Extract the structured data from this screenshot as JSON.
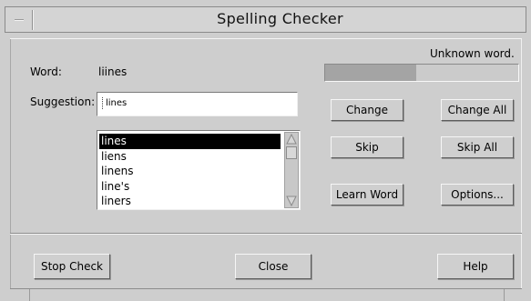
{
  "window": {
    "title": "Spelling Checker"
  },
  "status": {
    "message": "Unknown word.",
    "progress_fraction": 0.47
  },
  "word": {
    "label": "Word:",
    "value": "liines"
  },
  "suggestion": {
    "label": "Suggestion:",
    "value": "lines"
  },
  "suggestions_list": [
    "lines",
    "liens",
    "linens",
    "line's",
    "liners"
  ],
  "selected_index": 0,
  "buttons": {
    "change": "Change",
    "change_all": "Change All",
    "skip": "Skip",
    "skip_all": "Skip All",
    "learn_word": "Learn Word",
    "options": "Options...",
    "stop_check": "Stop Check",
    "close": "Close",
    "help": "Help"
  }
}
